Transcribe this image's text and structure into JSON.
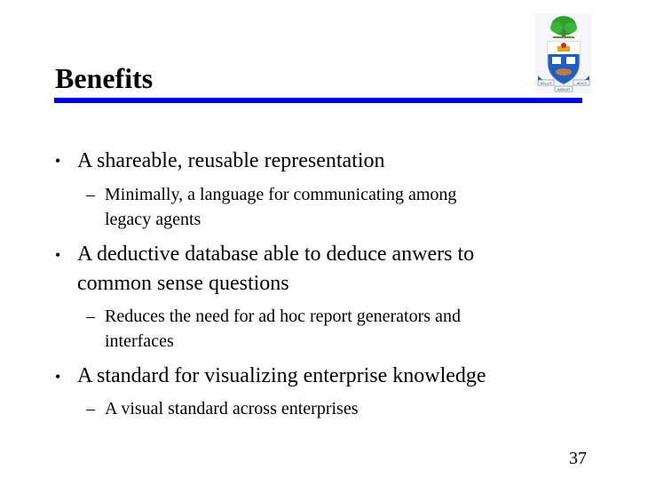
{
  "slide": {
    "title": "Benefits",
    "page_number": "37",
    "accent_color": "#0000e0",
    "logo": "university-crest",
    "bullets": [
      {
        "text_lines": [
          "A shareable, reusable representation"
        ],
        "subs": [
          {
            "text_lines": [
              "Minimally, a language for communicating among",
              "legacy agents"
            ]
          }
        ]
      },
      {
        "text_lines": [
          "A deductive database able to deduce anwers to",
          "common sense questions"
        ],
        "subs": [
          {
            "text_lines": [
              "Reduces the need for ad hoc report generators and",
              "interfaces"
            ]
          }
        ]
      },
      {
        "text_lines": [
          "A standard for visualizing enterprise knowledge"
        ],
        "subs": [
          {
            "text_lines": [
              "A visual standard across enterprises"
            ]
          }
        ]
      }
    ],
    "bullet_glyph": "•",
    "dash_glyph": "–",
    "crest_labels": [
      "VELUT",
      "ARBOR",
      "AEVO"
    ]
  }
}
